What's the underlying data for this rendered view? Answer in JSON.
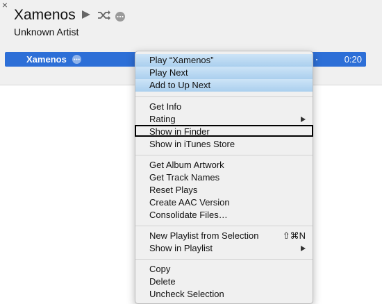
{
  "close_glyph": "×",
  "album": {
    "title": "Xamenos",
    "artist": "Unknown Artist"
  },
  "controls": {
    "play_icon": "play-icon",
    "shuffle_icon": "shuffle-icon",
    "more_icon": "ellipsis-circle-icon"
  },
  "track": {
    "name": "Xamenos",
    "time": "0:20",
    "row_color": "#2d6fd7"
  },
  "menu": {
    "groups": [
      {
        "items": [
          {
            "label": "Play “Xamenos”",
            "shortcut": "",
            "submenu": false,
            "highlighted": true
          },
          {
            "label": "Play Next",
            "shortcut": "",
            "submenu": false,
            "highlighted": true
          },
          {
            "label": "Add to Up Next",
            "shortcut": "",
            "submenu": false,
            "highlighted": true
          }
        ]
      },
      {
        "items": [
          {
            "label": "Get Info",
            "shortcut": "",
            "submenu": false
          },
          {
            "label": "Rating",
            "shortcut": "",
            "submenu": true
          },
          {
            "label": "Show in Finder",
            "shortcut": "",
            "submenu": false,
            "outlined": true
          },
          {
            "label": "Show in iTunes Store",
            "shortcut": "",
            "submenu": false
          }
        ]
      },
      {
        "items": [
          {
            "label": "Get Album Artwork",
            "shortcut": "",
            "submenu": false
          },
          {
            "label": "Get Track Names",
            "shortcut": "",
            "submenu": false
          },
          {
            "label": "Reset Plays",
            "shortcut": "",
            "submenu": false
          },
          {
            "label": "Create AAC Version",
            "shortcut": "",
            "submenu": false
          },
          {
            "label": "Consolidate Files…",
            "shortcut": "",
            "submenu": false
          }
        ]
      },
      {
        "items": [
          {
            "label": "New Playlist from Selection",
            "shortcut": "⇧⌘N",
            "submenu": false
          },
          {
            "label": "Show in Playlist",
            "shortcut": "",
            "submenu": true
          }
        ]
      },
      {
        "items": [
          {
            "label": "Copy",
            "shortcut": "",
            "submenu": false
          },
          {
            "label": "Delete",
            "shortcut": "",
            "submenu": false
          },
          {
            "label": "Uncheck Selection",
            "shortcut": "",
            "submenu": false
          }
        ]
      }
    ]
  }
}
